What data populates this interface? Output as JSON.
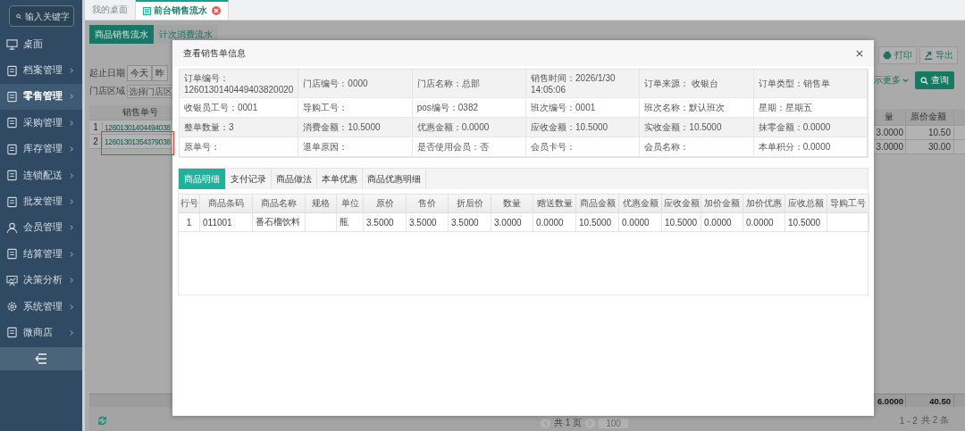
{
  "sidebar": {
    "search_placeholder": "输入关键字",
    "items": [
      {
        "label": "桌面",
        "selected": false,
        "has_arrow": false
      },
      {
        "label": "档案管理",
        "selected": false,
        "has_arrow": true
      },
      {
        "label": "零售管理",
        "selected": true,
        "has_arrow": true
      },
      {
        "label": "采购管理",
        "selected": false,
        "has_arrow": true
      },
      {
        "label": "库存管理",
        "selected": false,
        "has_arrow": true
      },
      {
        "label": "连锁配送",
        "selected": false,
        "has_arrow": true
      },
      {
        "label": "批发管理",
        "selected": false,
        "has_arrow": true
      },
      {
        "label": "会员管理",
        "selected": false,
        "has_arrow": true
      },
      {
        "label": "结算管理",
        "selected": false,
        "has_arrow": true
      },
      {
        "label": "决策分析",
        "selected": false,
        "has_arrow": true
      },
      {
        "label": "系统管理",
        "selected": false,
        "has_arrow": true
      },
      {
        "label": "微商店",
        "selected": false,
        "has_arrow": true
      }
    ]
  },
  "top_tabs": [
    {
      "label": "我的桌面",
      "selected": false
    },
    {
      "label": "前台销售流水",
      "selected": true
    }
  ],
  "sub_tabs": [
    {
      "label": "商品销售流水",
      "selected": true
    },
    {
      "label": "计次消费流水",
      "selected": false
    }
  ],
  "filters": {
    "date_label": "起止日期",
    "date_buttons": [
      "今天",
      "昨"
    ],
    "region_label": "门店区域",
    "region_placeholder": "选择门店区"
  },
  "left_table": {
    "header": "销售单号",
    "rows": [
      {
        "index": "1",
        "order_no": "12601301404494038",
        "highlighted": false
      },
      {
        "index": "2",
        "order_no": "12601301354379038",
        "highlighted": true
      }
    ]
  },
  "toolbar": {
    "buttons": [
      "打印",
      "导出"
    ],
    "more_link": "示更多",
    "query_button": "查询"
  },
  "right_table": {
    "columns": [
      "量",
      "原价金额"
    ],
    "rows": [
      [
        "3.0000",
        "10.50"
      ],
      [
        "3.0000",
        "30.00"
      ]
    ],
    "totals": [
      "6.0000",
      "40.50"
    ]
  },
  "pager": {
    "pages": "共 1 页",
    "page_size": "100",
    "range": "1 - 2",
    "total": "共 2 条"
  },
  "modal": {
    "title": "查看销售单信息",
    "info": [
      [
        "订单编号：1260130140449403820020",
        "门店编号：0000",
        "门店名称：总部",
        "销售时间：2026/1/30 14:05:06",
        "订单来源： 收银台",
        "订单类型：销售单"
      ],
      [
        "收银员工号：0001",
        "导购工号：",
        "pos编号：0382",
        "班次编号：0001",
        "班次名称：默认班次",
        "星期：星期五"
      ],
      [
        "整单数量：3",
        "消费金额：10.5000",
        "优惠金额：0.0000",
        "应收金额：10.5000",
        "实收金额：10.5000",
        "抹零金额：0.0000"
      ],
      [
        "原单号：",
        "退单原因：",
        "是否使用会员：否",
        "会员卡号：",
        "会员名称：",
        "本单积分：0.0000"
      ]
    ],
    "tabs": [
      {
        "label": "商品明细",
        "selected": true
      },
      {
        "label": "支付记录",
        "selected": false
      },
      {
        "label": "商品做法",
        "selected": false
      },
      {
        "label": "本单优惠",
        "selected": false
      },
      {
        "label": "商品优惠明细",
        "selected": false
      }
    ],
    "columns": [
      "行号",
      "商品条码",
      "商品名称",
      "规格",
      "单位",
      "原价",
      "售价",
      "折后价",
      "数量",
      "赠送数量",
      "商品金额",
      "优惠金额",
      "应收金额",
      "加价金额",
      "加价优惠",
      "应收总额",
      "导购工号"
    ],
    "rows": [
      [
        "1",
        "011001",
        "番石榴饮料",
        null,
        "瓶",
        "3.5000",
        "3.5000",
        "3.5000",
        "3.0000",
        "0.0000",
        "10.5000",
        "0.0000",
        "10.5000",
        "0.0000",
        "0.0000",
        "10.5000",
        null
      ]
    ]
  }
}
